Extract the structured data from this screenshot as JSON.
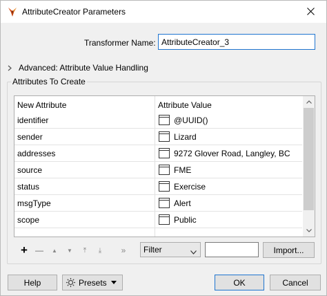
{
  "window": {
    "title": "AttributeCreator Parameters",
    "icons": {
      "app": "fme-transformer-icon",
      "close": "close-icon"
    }
  },
  "transformer": {
    "label": "Transformer Name:",
    "value": "AttributeCreator_3"
  },
  "advanced": {
    "label": "Advanced: Attribute Value Handling",
    "expanded": false
  },
  "attributes": {
    "group_title": "Attributes To Create",
    "columns": [
      "New Attribute",
      "Attribute Value"
    ],
    "rows": [
      {
        "name": "identifier",
        "value": "@UUID()"
      },
      {
        "name": "sender",
        "value": "Lizard"
      },
      {
        "name": "addresses",
        "value": "9272 Glover Road, Langley, BC"
      },
      {
        "name": "source",
        "value": "FME"
      },
      {
        "name": "status",
        "value": "Exercise"
      },
      {
        "name": "msgType",
        "value": "Alert"
      },
      {
        "name": "scope",
        "value": "Public"
      }
    ]
  },
  "toolbar": {
    "add": "+",
    "remove": "—",
    "move_up": "▲",
    "move_down": "▼",
    "move_top": "⤒",
    "move_bottom": "⤓",
    "more": "»",
    "filter_selected": "Filter",
    "import_label": "Import..."
  },
  "footer": {
    "help_label": "Help",
    "presets_label": "Presets",
    "ok_label": "OK",
    "cancel_label": "Cancel"
  },
  "colors": {
    "accent_border": "#1e74cf",
    "background": "#f0f0f0"
  }
}
